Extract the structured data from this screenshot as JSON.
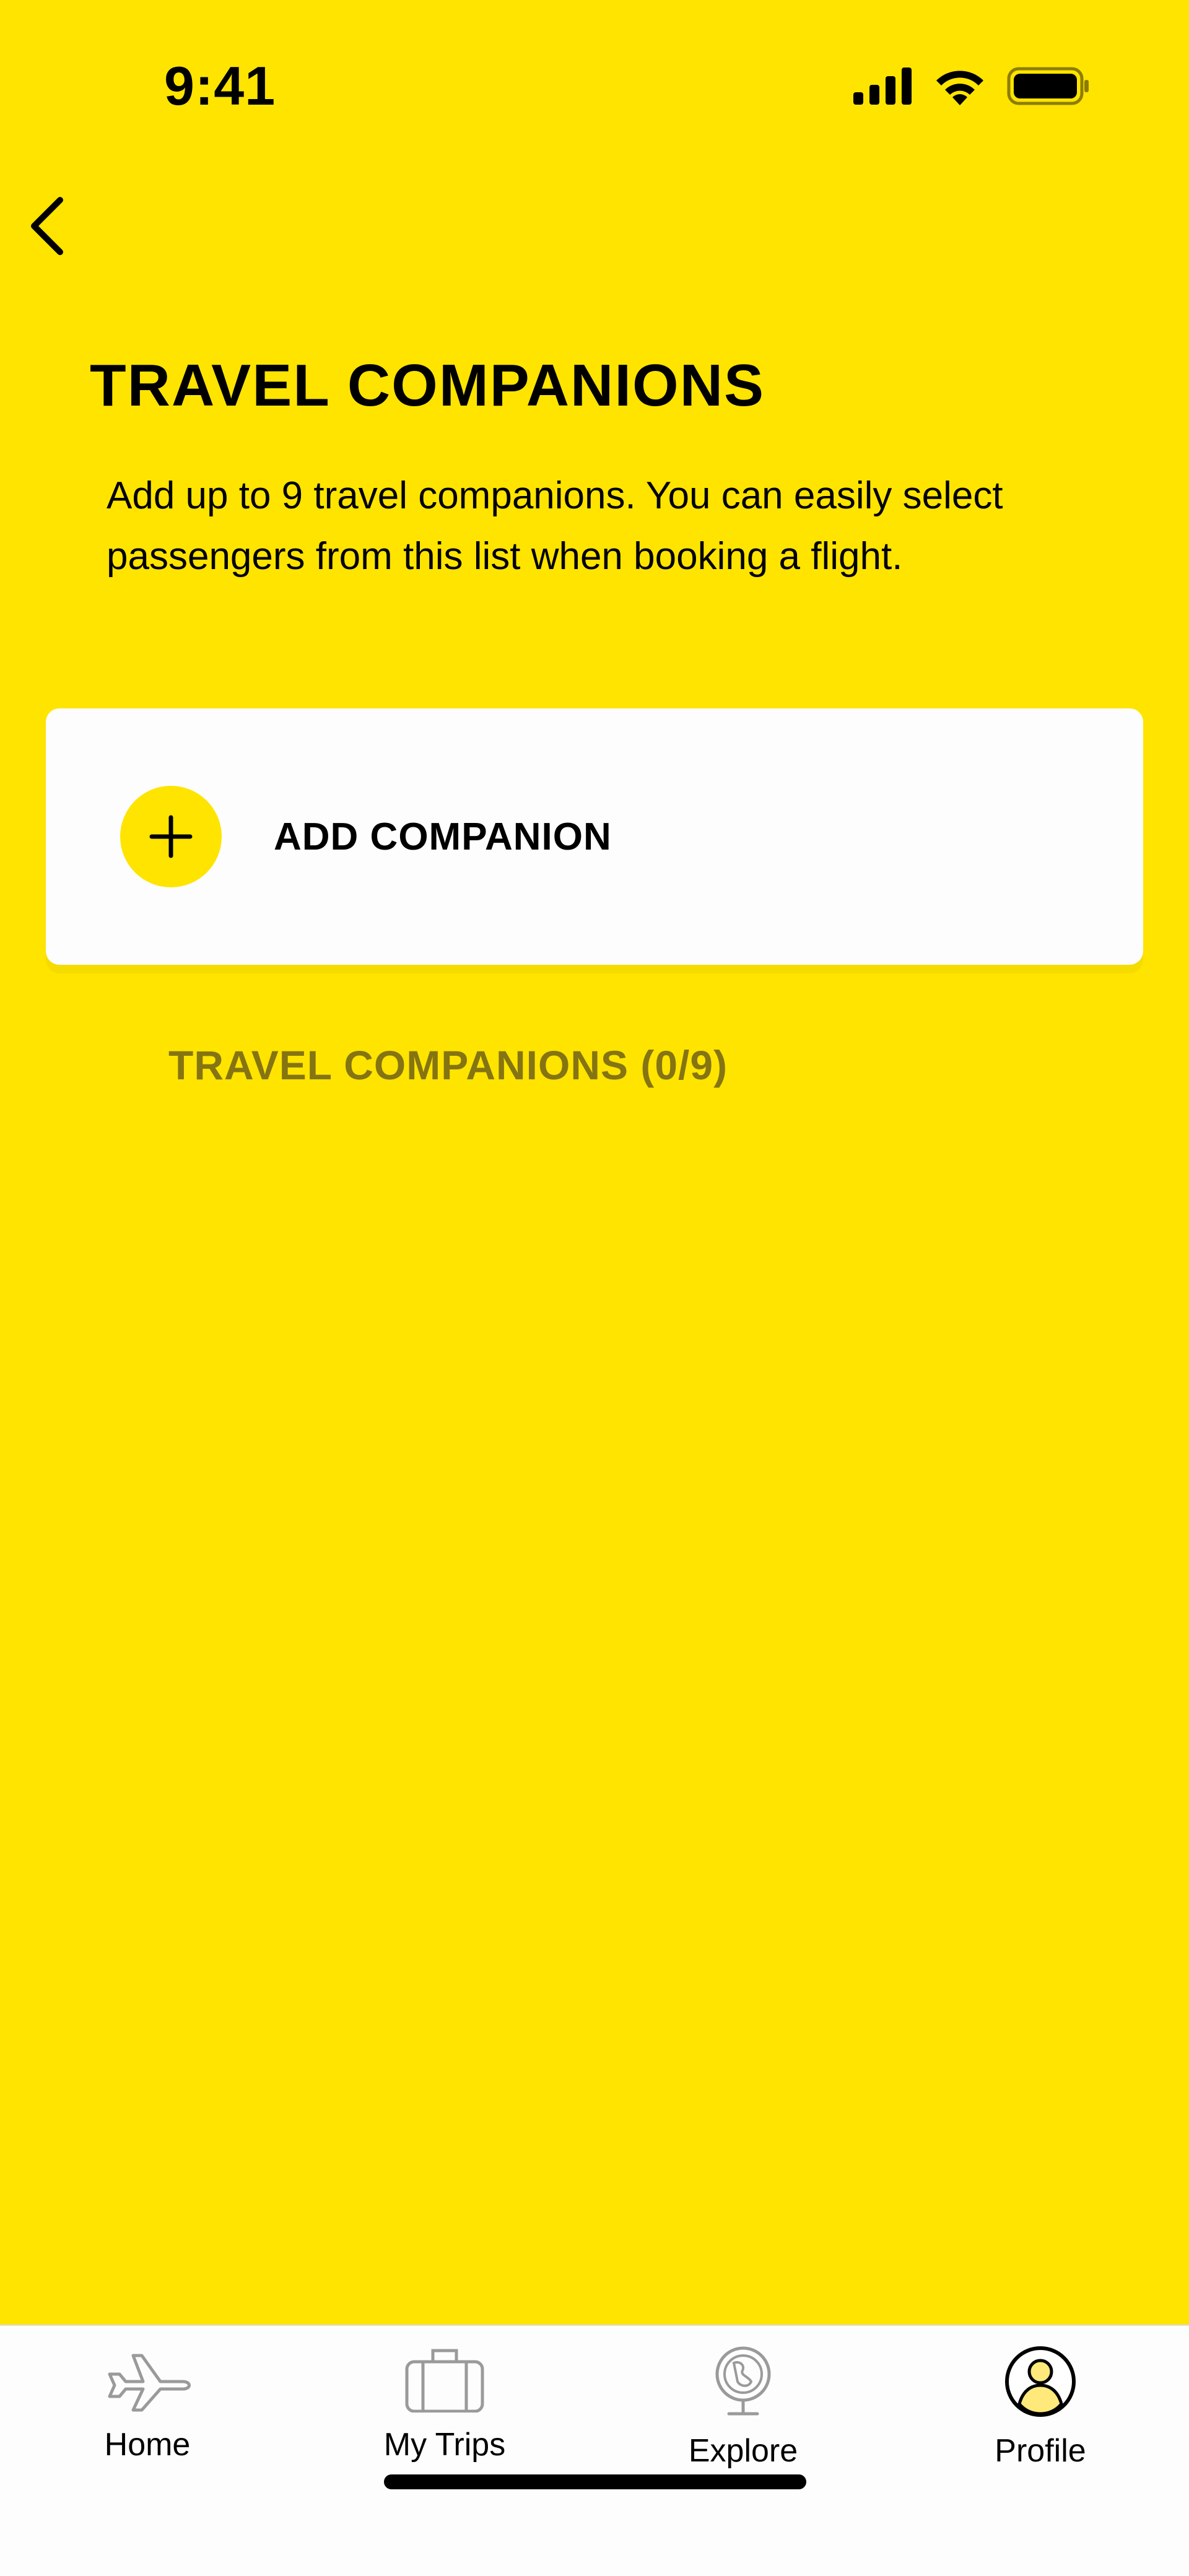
{
  "status_bar": {
    "time": "9:41",
    "icons": [
      "signal-icon",
      "wifi-icon",
      "battery-icon"
    ]
  },
  "header": {
    "back_icon": "chevron-left-icon",
    "title": "TRAVEL COMPANIONS"
  },
  "description": "Add up to 9 travel companions. You can easily select passengers from this list when booking a flight.",
  "add_card": {
    "icon": "plus-icon",
    "label": "ADD COMPANION"
  },
  "companions": {
    "label": "TRAVEL COMPANIONS (0/9)",
    "count": 0,
    "max": 9
  },
  "tab_bar": {
    "tabs": [
      {
        "label": "Home",
        "icon": "airplane-icon",
        "active": false
      },
      {
        "label": "My Trips",
        "icon": "suitcase-icon",
        "active": false
      },
      {
        "label": "Explore",
        "icon": "globe-icon",
        "active": false
      },
      {
        "label": "Profile",
        "icon": "profile-icon",
        "active": true
      }
    ]
  },
  "colors": {
    "background": "#FFE400",
    "card": "#FDFDFD",
    "muted_label": "#857412",
    "inactive_icon": "#9A9A9A"
  }
}
